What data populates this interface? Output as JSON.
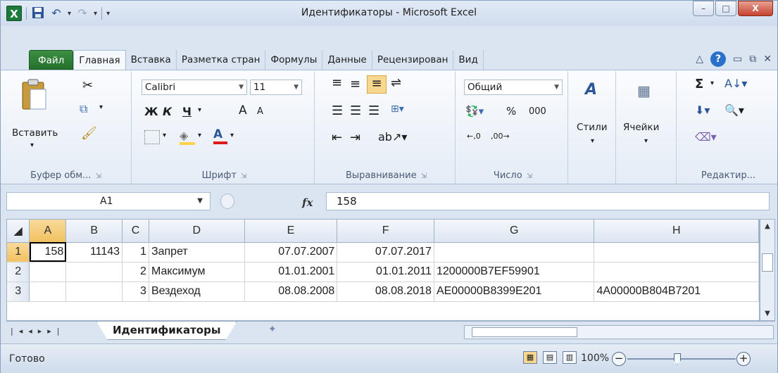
{
  "window": {
    "title": "Идентификаторы - Microsoft Excel",
    "app_logo": "X",
    "controls": {
      "minimize": "–",
      "maximize": "□",
      "close": "X"
    }
  },
  "quick_access": {
    "save_icon": "save-icon",
    "undo_icon": "undo-icon",
    "redo_icon": "redo-icon",
    "customize": "▾"
  },
  "tabs": [
    "Файл",
    "Главная",
    "Вставка",
    "Разметка стран",
    "Формулы",
    "Данные",
    "Рецензирован",
    "Вид"
  ],
  "active_tab": "Главная",
  "ribbon": {
    "clipboard": {
      "paste_label": "Вставить",
      "group_label": "Буфер обм..."
    },
    "font": {
      "family": "Calibri",
      "size": "11",
      "bold": "Ж",
      "italic": "К",
      "underline": "Ч",
      "grow": "A",
      "shrink": "A",
      "group_label": "Шрифт",
      "accent_fill": "#ffd24a",
      "accent_font": "#e01b1b"
    },
    "alignment": {
      "group_label": "Выравнивание"
    },
    "number": {
      "format": "Общий",
      "percent": "%",
      "thousands": "000",
      "group_label": "Число"
    },
    "styles": {
      "label": "Стили"
    },
    "cells": {
      "label": "Ячейки"
    },
    "editing": {
      "sum": "Σ",
      "group_label": "Редактир..."
    }
  },
  "formula_bar": {
    "name_box": "A1",
    "fx": "fx",
    "value": "158"
  },
  "sheet": {
    "columns": [
      "A",
      "B",
      "C",
      "D",
      "E",
      "F",
      "G",
      "H"
    ],
    "rows": [
      {
        "n": "1",
        "cells": [
          "158",
          "11143",
          "1",
          "Запрет",
          "07.07.2007",
          "07.07.2017",
          "",
          ""
        ]
      },
      {
        "n": "2",
        "cells": [
          "",
          "",
          "2",
          "Максимум",
          "01.01.2001",
          "01.01.2011",
          "1200000B7EF59901",
          ""
        ]
      },
      {
        "n": "3",
        "cells": [
          "",
          "",
          "3",
          "Вездеход",
          "08.08.2008",
          "08.08.2018",
          "AE00000B8399E201",
          "4A00000B804B7201"
        ]
      }
    ]
  },
  "sheet_tabs": {
    "active": "Идентификаторы"
  },
  "status": {
    "ready": "Готово",
    "zoom": "100%"
  }
}
